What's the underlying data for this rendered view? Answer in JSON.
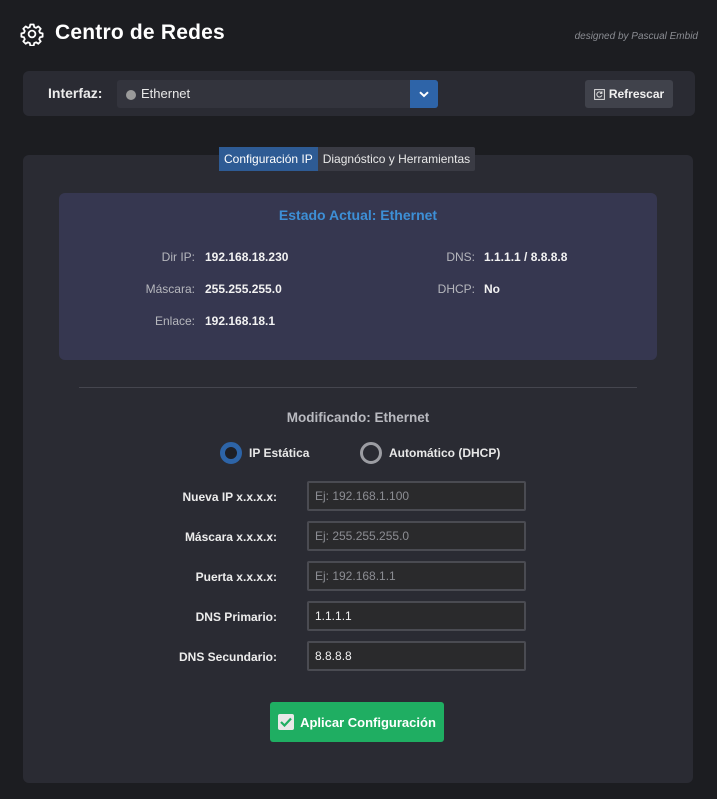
{
  "header": {
    "title": "Centro de Redes",
    "credit": "designed by Pascual Embid",
    "icon": "gear-icon"
  },
  "interface_bar": {
    "label": "Interfaz:",
    "selected": "Ethernet",
    "refresh_label": "Refrescar",
    "accent": "#2e64a8"
  },
  "tabs": [
    {
      "label": "Configuración IP",
      "active": true
    },
    {
      "label": "Diagnóstico y Herramientas",
      "active": false
    }
  ],
  "status": {
    "title": "Estado Actual: Ethernet",
    "ip_label": "Dir IP:",
    "ip_value": "192.168.18.230",
    "mask_label": "Máscara:",
    "mask_value": "255.255.255.0",
    "gateway_label": "Enlace:",
    "gateway_value": "192.168.18.1",
    "dns_label": "DNS:",
    "dns_value": "1.1.1.1 / 8.8.8.8",
    "dhcp_label": "DHCP:",
    "dhcp_value": "No",
    "title_color": "#3d8fd6"
  },
  "config": {
    "title": "Modificando: Ethernet",
    "static_label": "IP Estática",
    "dhcp_label": "Automático (DHCP)",
    "selected_mode": "static",
    "fields": [
      {
        "label": "Nueva IP x.x.x.x:",
        "value": "",
        "placeholder": "Ej: 192.168.1.100"
      },
      {
        "label": "Máscara x.x.x.x:",
        "value": "",
        "placeholder": "Ej: 255.255.255.0"
      },
      {
        "label": "Puerta x.x.x.x:",
        "value": "",
        "placeholder": "Ej: 192.168.1.1"
      },
      {
        "label": "DNS Primario:",
        "value": "1.1.1.1",
        "placeholder": ""
      },
      {
        "label": "DNS Secundario:",
        "value": "8.8.8.8",
        "placeholder": ""
      }
    ],
    "apply_label": "Aplicar Configuración",
    "apply_color": "#1fae62"
  }
}
